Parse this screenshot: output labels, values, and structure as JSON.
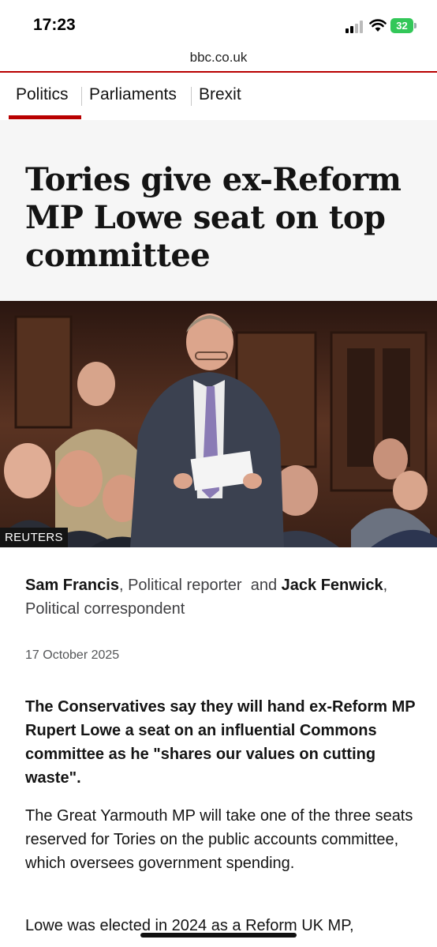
{
  "status_bar": {
    "time": "17:23",
    "battery": "32"
  },
  "url_bar": {
    "domain": "bbc.co.uk"
  },
  "nav": {
    "items": [
      "Politics",
      "Parliaments",
      "Brexit"
    ]
  },
  "article": {
    "headline": "Tories give ex-Reform MP Lowe seat on top committee",
    "image_credit": "REUTERS",
    "byline": {
      "author1": "Sam Francis",
      "role1": ", Political reporter",
      "and": "and",
      "author2": "Jack Fenwick",
      "role2": ", Political correspondent"
    },
    "date": "17 October 2025",
    "lead": "The Conservatives say they will hand ex-Reform MP Rupert Lowe a seat on an influential Commons committee as he \"shares our values on cutting waste\".",
    "paragraph1": "The Great Yarmouth MP will take one of the three seats reserved for Tories on the public accounts committee, which oversees government spending.",
    "paragraph2": "Lowe was elected in 2024 as a Reform UK MP,"
  },
  "colors": {
    "accent": "#b80000",
    "headline_bg": "#f6f6f6",
    "battery": "#33c759"
  }
}
